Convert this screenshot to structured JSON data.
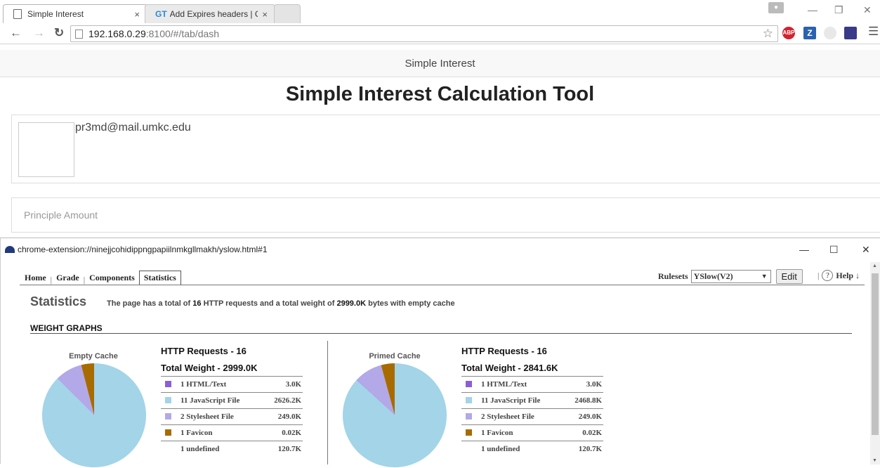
{
  "browser": {
    "tabs": [
      {
        "title": "Simple Interest",
        "close": "×"
      },
      {
        "logo": "GT",
        "title": "Add Expires headers | GTm",
        "close": "×"
      }
    ],
    "url_host": "192.168.0.29",
    "url_path": ":8100/#/tab/dash",
    "extensions": [
      {
        "name": "adblock-plus",
        "text": "ABP",
        "color": "#d3232f"
      },
      {
        "name": "zotero",
        "text": "Z",
        "color": "#2b62b0"
      },
      {
        "name": "gray-ext",
        "text": "",
        "color": "#d8d8d8"
      },
      {
        "name": "yslow-ext",
        "text": "",
        "color": "#3a3a8a"
      }
    ]
  },
  "app": {
    "header": "Simple Interest",
    "title": "Simple Interest Calculation Tool",
    "user_email": "pr3md@mail.umkc.edu",
    "principle_placeholder": "Principle Amount"
  },
  "popup": {
    "url": "chrome-extension://ninejjcohidippngpapiilnmkgllmakh/yslow.html#1",
    "tabs": [
      "Home",
      "Grade",
      "Components",
      "Statistics"
    ],
    "active_tab": "Statistics",
    "rulesets_label": "Rulesets",
    "ruleset_value": "YSlow(V2)",
    "edit_label": "Edit",
    "help_label": "Help ↓",
    "stats_title": "Statistics",
    "stats_desc_prefix": "The page has a total of",
    "stats_requests": "16",
    "stats_desc_mid": "HTTP requests and a total weight of",
    "stats_weight": "2999.0K",
    "stats_desc_suffix": "bytes with empty cache",
    "weight_graphs_title": "WEIGHT GRAPHS",
    "empty_cache": {
      "label": "Empty Cache",
      "requests": "HTTP Requests - 16",
      "total": "Total Weight - 2999.0K",
      "rows": [
        {
          "label": "1 HTML/Text",
          "size": "3.0K",
          "color": "#8a5fd6",
          "kb": 3.0
        },
        {
          "label": "11 JavaScript File",
          "size": "2626.2K",
          "color": "#a3d4e8",
          "kb": 2626.2
        },
        {
          "label": "2 Stylesheet File",
          "size": "249.0K",
          "color": "#b3a8e8",
          "kb": 249.0
        },
        {
          "label": "1 Favicon",
          "size": "0.02K",
          "color": "#a86b00",
          "kb": 0.02
        },
        {
          "label": "1 undefined",
          "size": "120.7K",
          "color": "",
          "kb": 120.7
        }
      ]
    },
    "primed_cache": {
      "label": "Primed Cache",
      "requests": "HTTP Requests - 16",
      "total": "Total Weight - 2841.6K",
      "rows": [
        {
          "label": "1 HTML/Text",
          "size": "3.0K",
          "color": "#8a5fd6",
          "kb": 3.0
        },
        {
          "label": "11 JavaScript File",
          "size": "2468.8K",
          "color": "#a3d4e8",
          "kb": 2468.8
        },
        {
          "label": "2 Stylesheet File",
          "size": "249.0K",
          "color": "#b3a8e8",
          "kb": 249.0
        },
        {
          "label": "1 Favicon",
          "size": "0.02K",
          "color": "#a86b00",
          "kb": 0.02
        },
        {
          "label": "1 undefined",
          "size": "120.7K",
          "color": "",
          "kb": 120.7
        }
      ]
    }
  }
}
